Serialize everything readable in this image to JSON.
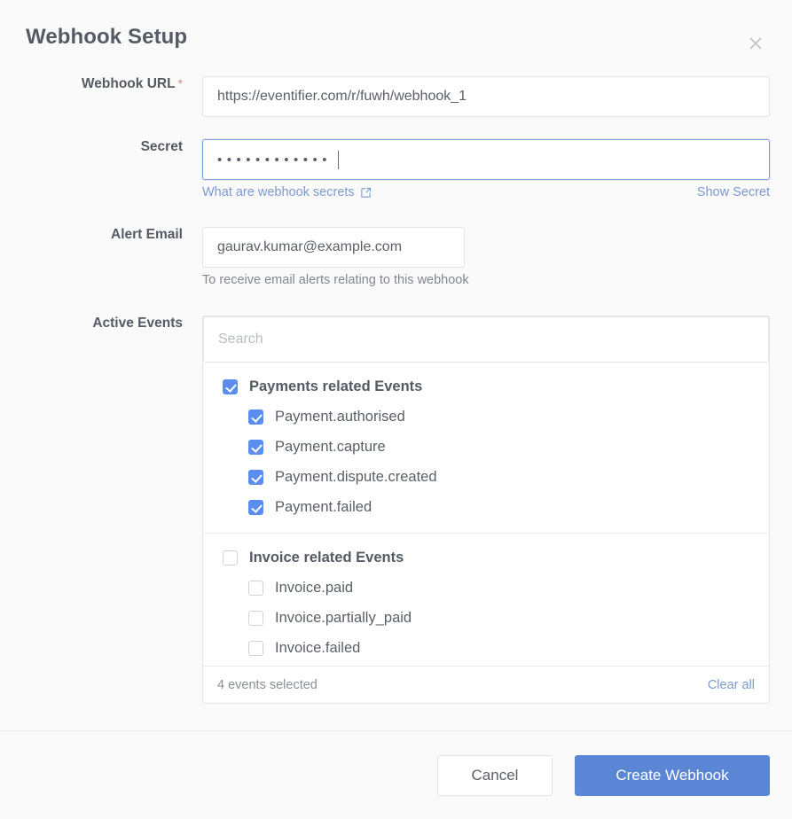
{
  "header": {
    "title": "Webhook Setup",
    "close_icon": "close-icon"
  },
  "form": {
    "webhook_url": {
      "label": "Webhook URL",
      "required_marker": "*",
      "value": "https://eventifier.com/r/fuwh/webhook_1",
      "placeholder": ""
    },
    "secret": {
      "label": "Secret",
      "masked_value": "••••••••••••",
      "dot_count": 12,
      "help_link": "What are webhook secrets",
      "help_link_icon": "external-link-icon",
      "toggle_link": "Show Secret"
    },
    "alert_email": {
      "label": "Alert Email",
      "value": "gaurav.kumar@example.com",
      "helper": "To receive email alerts relating to this webhook"
    },
    "active_events": {
      "label": "Active Events",
      "search_placeholder": "Search",
      "groups": [
        {
          "name": "Payments related Events",
          "checked": true,
          "items": [
            {
              "name": "Payment.authorised",
              "checked": true
            },
            {
              "name": "Payment.capture",
              "checked": true
            },
            {
              "name": "Payment.dispute.created",
              "checked": true
            },
            {
              "name": "Payment.failed",
              "checked": true
            }
          ]
        },
        {
          "name": "Invoice related Events",
          "checked": false,
          "items": [
            {
              "name": "Invoice.paid",
              "checked": false
            },
            {
              "name": "Invoice.partially_paid",
              "checked": false
            },
            {
              "name": "Invoice.failed",
              "checked": false
            }
          ]
        }
      ],
      "selected_summary": "4 events selected",
      "clear_all": "Clear all"
    }
  },
  "footer": {
    "cancel_label": "Cancel",
    "submit_label": "Create Webhook"
  },
  "colors": {
    "accent": "#5b86d6",
    "checkbox": "#5b8def",
    "link": "#7b9ad2",
    "required": "#d98d8d",
    "page_bg": "#fafafa",
    "border": "#e2e4e8"
  }
}
